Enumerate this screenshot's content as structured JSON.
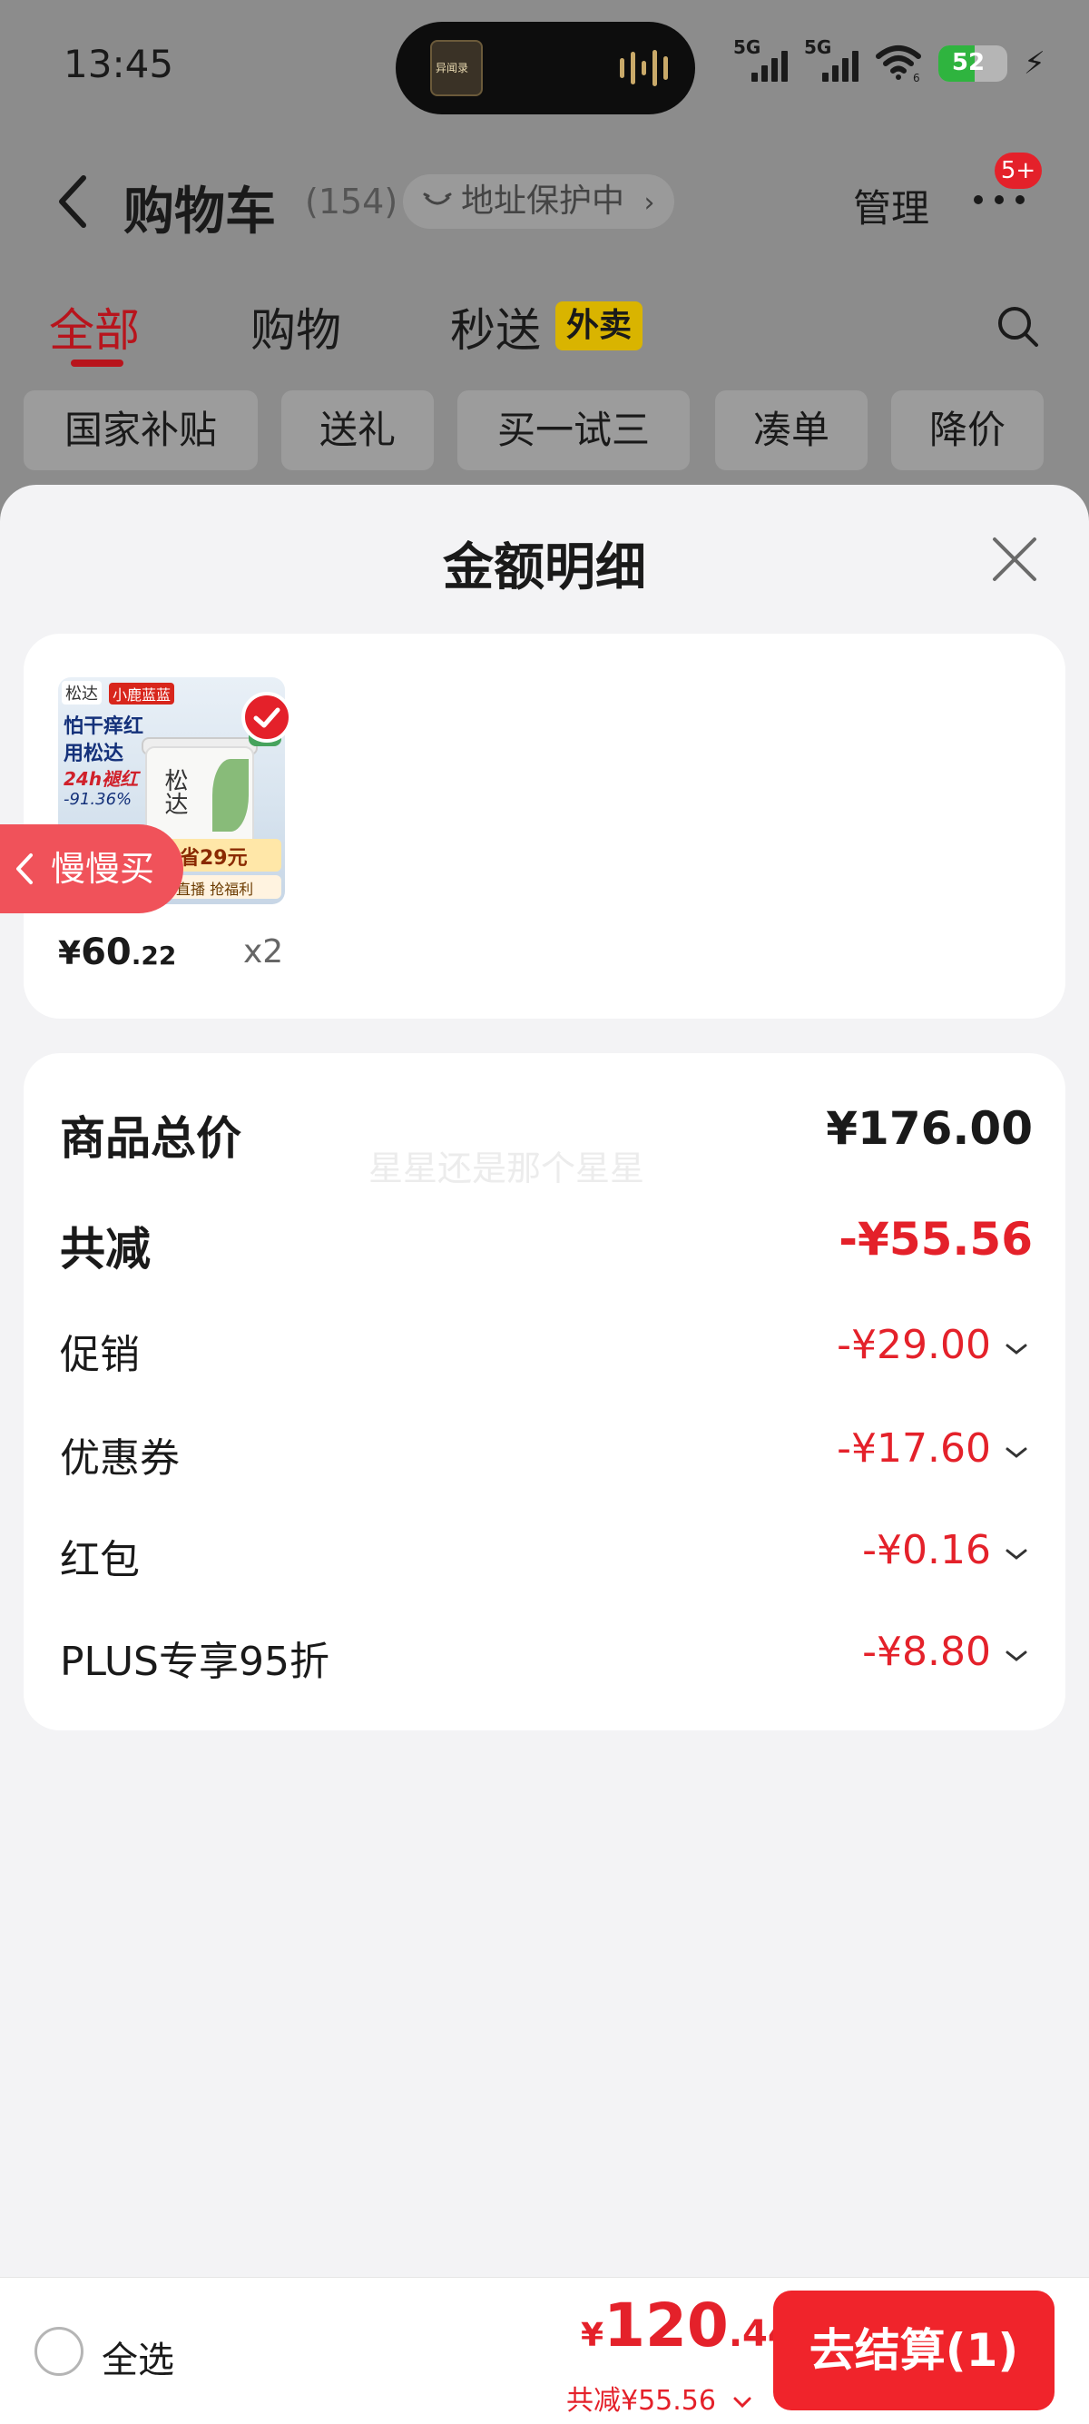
{
  "status_bar": {
    "time": "13:45",
    "network_1": "5G",
    "network_2": "5G",
    "wifi_label": "6",
    "battery": "52",
    "album_text": "异闻录"
  },
  "nav": {
    "title": "购物车",
    "count": "(154)",
    "address_protect": "地址保护中",
    "address_arrow": "›",
    "manage": "管理",
    "more_badge": "5+"
  },
  "tabs": [
    {
      "label": "全部",
      "active": true
    },
    {
      "label": "购物",
      "active": false
    },
    {
      "label": "秒送",
      "active": false
    }
  ],
  "tab_badge": "外卖",
  "chips": [
    "国家补贴",
    "送礼",
    "买一试三",
    "凑单",
    "降价"
  ],
  "sheet": {
    "title": "金额明细",
    "product": {
      "image_text": {
        "brand": "松达",
        "brand2": "小鹿蓝蓝",
        "line1": "怕干痒红",
        "line2": "用松达",
        "line3": "24h褪红",
        "line4": "-91.36%",
        "jar": "松达",
        "save": "立省29元",
        "live": "看直播 抢福利"
      },
      "price_currency": "¥",
      "price_int": "60",
      "price_dec": ".22",
      "quantity": "x2"
    },
    "slow_buy": "慢慢买",
    "watermark": "星星还是那个星星",
    "summary": {
      "total_label": "商品总价",
      "total_value": "¥176.00",
      "discount_label": "共减",
      "discount_value": "-¥55.56",
      "items": [
        {
          "label": "促销",
          "value": "-¥29.00"
        },
        {
          "label": "优惠券",
          "value": "-¥17.60"
        },
        {
          "label": "红包",
          "value": "-¥0.16"
        },
        {
          "label": "PLUS专享95折",
          "value": "-¥8.80"
        }
      ]
    }
  },
  "footer": {
    "select_all": "全选",
    "total_currency": "¥",
    "total_int": "120",
    "total_dec": ".44",
    "saved": "共减¥55.56",
    "checkout": "去结算(1)"
  },
  "colors": {
    "accent_red": "#e4212a",
    "tab_active": "#b8141c",
    "badge_yellow": "#d9b400"
  }
}
